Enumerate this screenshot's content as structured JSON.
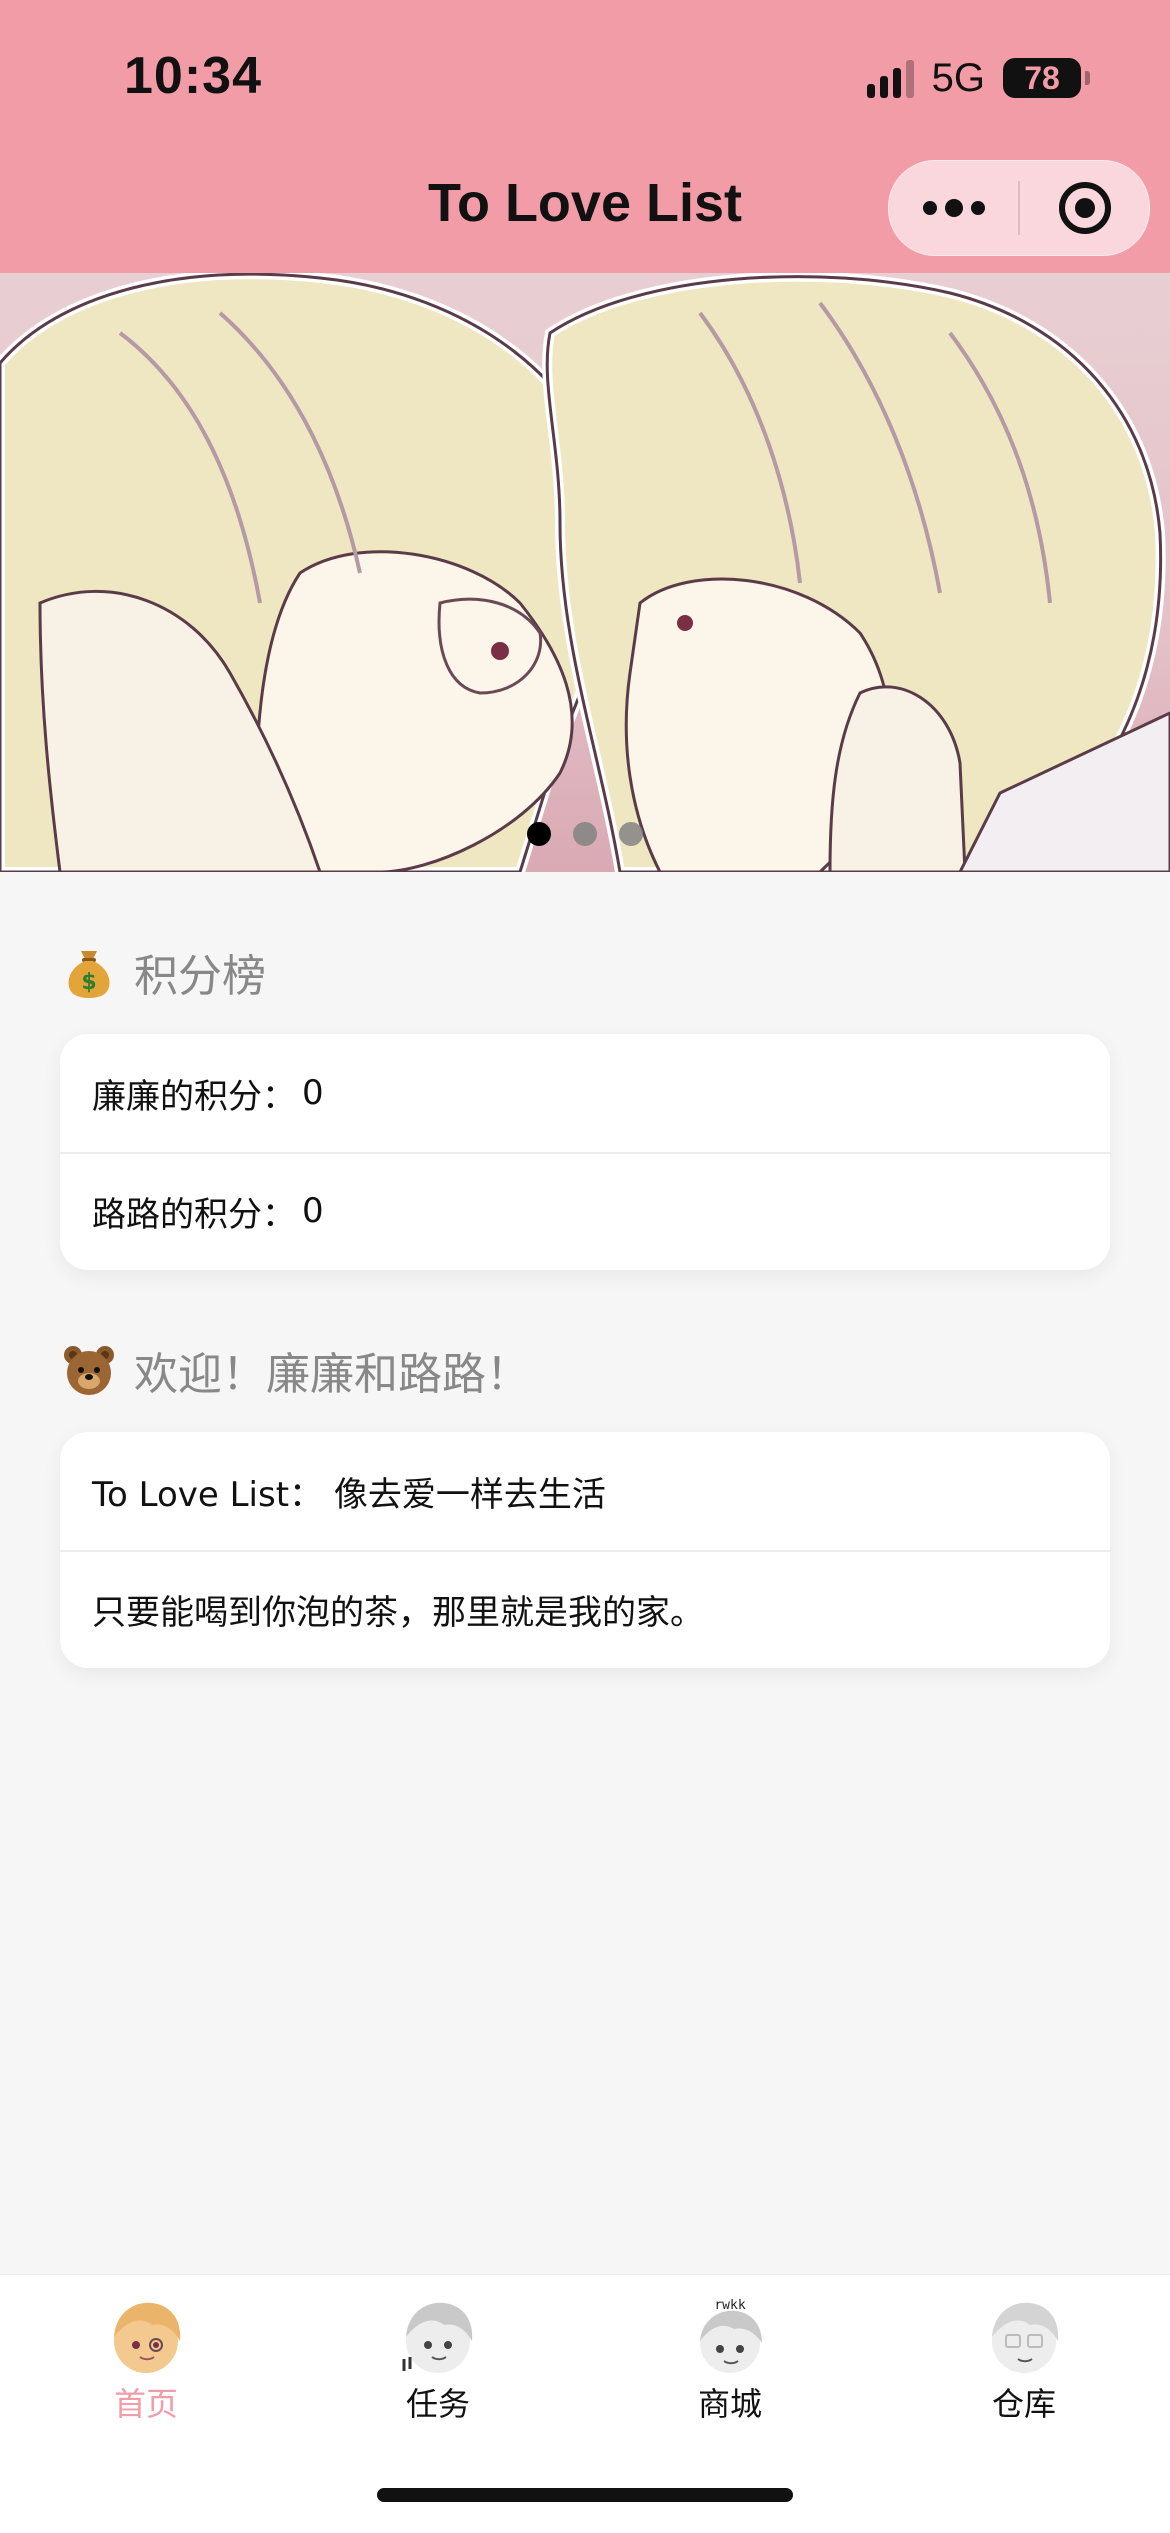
{
  "status": {
    "time": "10:34",
    "network": "5G",
    "battery": "78"
  },
  "header": {
    "title": "To Love List",
    "icons": [
      "more-icon",
      "target-icon"
    ]
  },
  "banner": {
    "slides": 3,
    "active_slide": 1
  },
  "leaderboard": {
    "icon": "money-bag-icon",
    "title": "积分榜",
    "rows": [
      {
        "label": "廉廉的积分：",
        "value": "0"
      },
      {
        "label": "路路的积分：",
        "value": "0"
      }
    ]
  },
  "welcome": {
    "icon": "bear-icon",
    "title": "欢迎！廉廉和路路！",
    "rows": [
      {
        "text": "To Love List：  像去爱一样去生活"
      },
      {
        "text": "只要能喝到你泡的茶，那里就是我的家。"
      }
    ]
  },
  "tabbar": {
    "active_color": "#f29ca8",
    "items": [
      {
        "label": "首页",
        "active": true
      },
      {
        "label": "任务",
        "active": false
      },
      {
        "label": "商城",
        "active": false
      },
      {
        "label": "仓库",
        "active": false
      }
    ]
  },
  "colors": {
    "header_bg": "#f29ca8",
    "page_bg": "#f6f6f6"
  }
}
